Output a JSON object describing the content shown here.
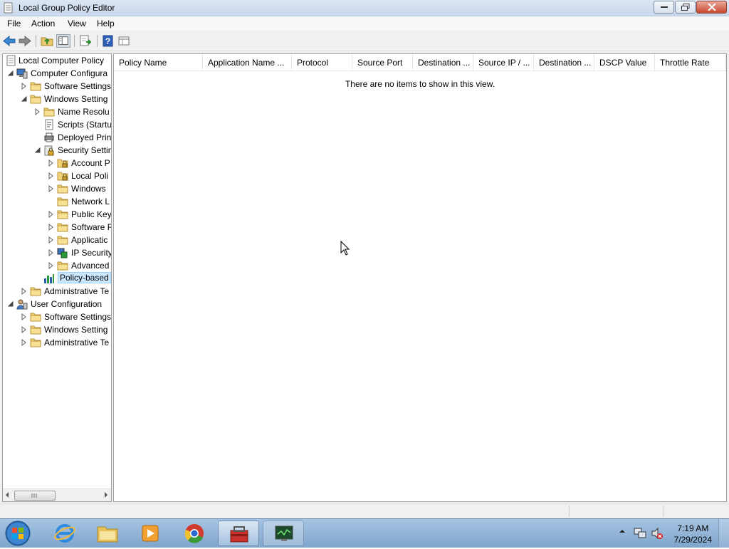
{
  "window": {
    "title": "Local Group Policy Editor"
  },
  "menu": [
    "File",
    "Action",
    "View",
    "Help"
  ],
  "toolbar_icons": [
    "back-icon",
    "forward-icon",
    "up-folder-icon",
    "show-hide-tree-icon",
    "export-list-icon",
    "help-icon",
    "properties-icon"
  ],
  "tree": {
    "root": "Local Computer Policy",
    "items": [
      {
        "label": "Computer Configura",
        "icon": "computer-icon"
      },
      {
        "label": "Software Settings",
        "icon": "folder-icon"
      },
      {
        "label": "Windows Setting",
        "icon": "folder-icon"
      },
      {
        "label": "Name Resolu",
        "icon": "folder-icon"
      },
      {
        "label": "Scripts (Startu",
        "icon": "script-icon"
      },
      {
        "label": "Deployed Prin",
        "icon": "printer-icon"
      },
      {
        "label": "Security Settin",
        "icon": "security-icon"
      },
      {
        "label": "Account P",
        "icon": "lock-folder-icon"
      },
      {
        "label": "Local Poli",
        "icon": "lock-folder-icon"
      },
      {
        "label": "Windows",
        "icon": "folder-icon"
      },
      {
        "label": "Network L",
        "icon": "folder-icon"
      },
      {
        "label": "Public Key",
        "icon": "folder-icon"
      },
      {
        "label": "Software R",
        "icon": "folder-icon"
      },
      {
        "label": "Applicatic",
        "icon": "folder-icon"
      },
      {
        "label": "IP Security",
        "icon": "ipsec-icon"
      },
      {
        "label": "Advanced",
        "icon": "folder-icon"
      },
      {
        "label": "Policy-based",
        "icon": "qos-chart-icon"
      },
      {
        "label": "Administrative Te",
        "icon": "folder-icon"
      },
      {
        "label": "User Configuration",
        "icon": "user-icon"
      },
      {
        "label": "Software Settings",
        "icon": "folder-icon"
      },
      {
        "label": "Windows Setting",
        "icon": "folder-icon"
      },
      {
        "label": "Administrative Te",
        "icon": "folder-icon"
      }
    ]
  },
  "columns": [
    "Policy Name",
    "Application Name ...",
    "Protocol",
    "Source Port",
    "Destination ...",
    "Source IP / ...",
    "Destination ...",
    "DSCP Value",
    "Throttle Rate"
  ],
  "empty_message": "There are no items to show in this view.",
  "taskbar": {
    "apps": [
      "internet-explorer-icon",
      "windows-explorer-icon",
      "media-player-icon",
      "chrome-icon",
      "toolbox-icon",
      "monitor-icon"
    ],
    "time": "7:19 AM",
    "date": "7/29/2024"
  },
  "colors": {
    "selection": "#cce8ff",
    "titlebar": "#dbe6f3",
    "taskbar": "#8fb2d6"
  }
}
